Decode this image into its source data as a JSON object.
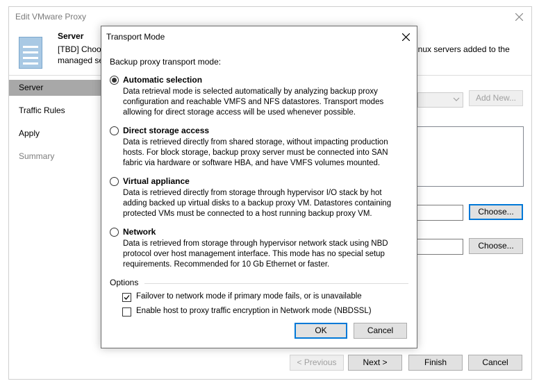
{
  "outer": {
    "title": "Edit VMware Proxy",
    "header_title": "Server",
    "header_desc_line1": "[TBD] Choo",
    "header_desc_line2": "managed se",
    "header_desc_right": "inux servers added to the",
    "nav": [
      "Server",
      "Traffic Rules",
      "Apply",
      "Summary"
    ],
    "add_new_label": "Add New...",
    "choose_label_1": "Choose...",
    "choose_label_2": "Choose...",
    "previous_label": "< Previous",
    "next_label": "Next >",
    "finish_label": "Finish",
    "cancel_label": "Cancel"
  },
  "dialog": {
    "title": "Transport Mode",
    "group_label": "Backup proxy transport mode:",
    "modes": [
      {
        "title": "Automatic selection",
        "desc": "Data retrieval mode is selected automatically by analyzing backup proxy configuration and reachable VMFS and NFS datastores. Transport modes allowing for direct storage access will be used whenever possible.",
        "selected": true
      },
      {
        "title": "Direct storage access",
        "desc": "Data is retrieved directly from shared storage, without impacting production hosts. For block storage, backup proxy server must be connected into SAN fabric via hardware or software HBA, and have VMFS volumes mounted.",
        "selected": false
      },
      {
        "title": "Virtual appliance",
        "desc": "Data is retrieved directly from storage through hypervisor I/O stack by hot adding backed up virtual disks to a backup proxy VM. Datastores containing protected VMs must be connected to a host running backup proxy VM.",
        "selected": false
      },
      {
        "title": "Network",
        "desc": "Data is retrieved from storage through hypervisor network stack using NBD protocol over host management interface. This mode has no special setup requirements. Recommended for 10 Gb Ethernet or faster.",
        "selected": false
      }
    ],
    "options_label": "Options",
    "failover_label": "Failover to network mode if primary mode fails, or is unavailable",
    "failover_checked": true,
    "encryption_label": "Enable host to proxy traffic encryption in Network mode (NBDSSL)",
    "encryption_checked": false,
    "ok_label": "OK",
    "cancel_label": "Cancel"
  },
  "icons": {
    "close": "close-icon",
    "server": "server-icon",
    "dropdown": "chevron-down-icon",
    "check": "checkmark-icon"
  }
}
